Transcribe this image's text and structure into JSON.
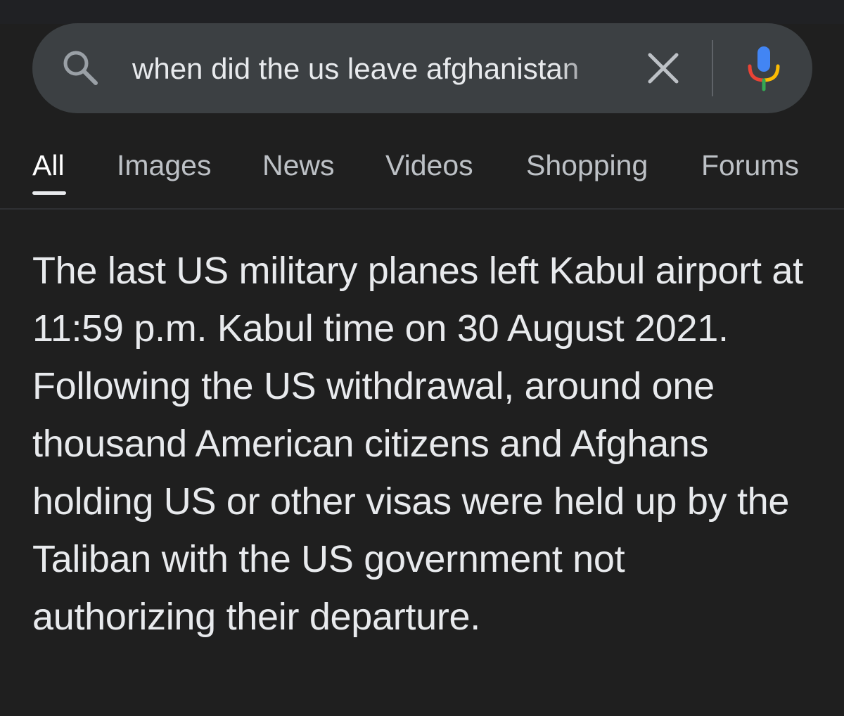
{
  "search": {
    "query": "when did the us leave afghanistan",
    "icons": {
      "search": "search-icon",
      "clear": "close-icon",
      "mic": "microphone-icon"
    }
  },
  "tabs": [
    {
      "label": "All",
      "active": true
    },
    {
      "label": "Images",
      "active": false
    },
    {
      "label": "News",
      "active": false
    },
    {
      "label": "Videos",
      "active": false
    },
    {
      "label": "Shopping",
      "active": false
    },
    {
      "label": "Forums",
      "active": false
    }
  ],
  "answer": {
    "text": "The last US military planes left Kabul airport at 11:59 p.m. Kabul time on 30 August 2021. Following the US withdrawal, around one thousand American citizens and Afghans holding US or other visas were held up by the Taliban with the US government not authorizing their departure."
  },
  "colors": {
    "background": "#1f1f1f",
    "search_bar": "#3c4043",
    "text_primary": "#e8eaed",
    "text_secondary": "#bdc1c6",
    "mic_blue": "#4285f4",
    "mic_red": "#ea4335",
    "mic_yellow": "#fbbc04",
    "mic_green": "#34a853"
  }
}
